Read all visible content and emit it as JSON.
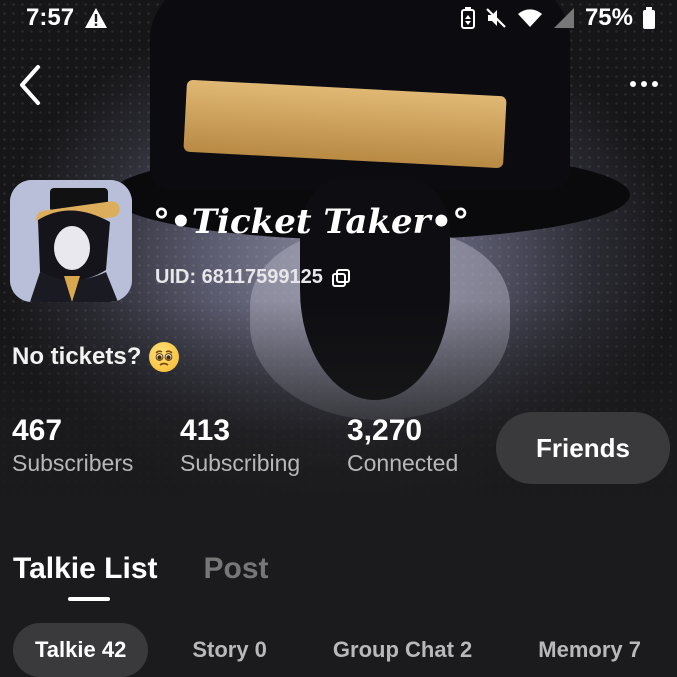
{
  "status_bar": {
    "time": "7:57",
    "battery": "75%"
  },
  "profile": {
    "name": "°•Ticket Taker•°",
    "uid": "UID: 68117599125",
    "bio": "No tickets?"
  },
  "stats": [
    {
      "value": "467",
      "label": "Subscribers"
    },
    {
      "value": "413",
      "label": "Subscribing"
    },
    {
      "value": "3,270",
      "label": "Connected"
    }
  ],
  "friends_button": "Friends",
  "tabs": [
    {
      "label": "Talkie List",
      "active": true
    },
    {
      "label": "Post",
      "active": false
    }
  ],
  "chips": [
    {
      "label": "Talkie 42",
      "active": true
    },
    {
      "label": "Story 0",
      "active": false
    },
    {
      "label": "Group Chat 2",
      "active": false
    },
    {
      "label": "Memory 7",
      "active": false
    }
  ],
  "icons": {
    "back": "chevron-left-icon",
    "more": "more-horizontal-icon",
    "copy": "copy-icon",
    "warning": "warning-icon",
    "battery-saver": "battery-saver-icon",
    "mute": "mute-icon",
    "wifi": "wifi-icon",
    "signal": "signal-icon",
    "battery": "battery-icon",
    "emoji": "pleading-face-icon"
  },
  "colors": {
    "background": "#1b1b1d",
    "chip_active_bg": "#3a3a3d",
    "inactive_text": "#777777",
    "band_gold": "#d8ac62"
  }
}
